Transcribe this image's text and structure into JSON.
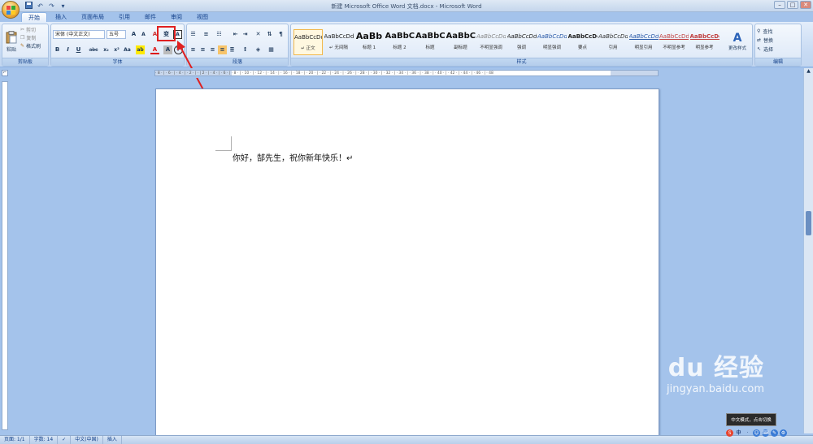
{
  "window": {
    "title": "新建 Microsoft Office Word 文档.docx - Microsoft Word",
    "controls": [
      "–",
      "□",
      "✕"
    ]
  },
  "qat": {
    "save_icon": "save-icon",
    "undo": "↶",
    "redo": "↷",
    "more": "▾"
  },
  "tabs": [
    "开始",
    "插入",
    "页面布局",
    "引用",
    "邮件",
    "审阅",
    "视图"
  ],
  "active_tab": "开始",
  "clipboard": {
    "paste": "粘贴",
    "cut": "剪切",
    "copy": "复制",
    "format_painter": "格式刷",
    "label": "剪贴板"
  },
  "font": {
    "name": "宋体 (中文正文)",
    "size": "五号",
    "grow": "A",
    "shrink": "A",
    "clear": "A",
    "phonetic": "变",
    "border": "A",
    "bold": "B",
    "italic": "I",
    "underline": "U",
    "strike": "abc",
    "subscript": "x₂",
    "superscript": "x²",
    "case": "Aa",
    "highlight": "ab",
    "color": "A",
    "shade": "A",
    "circle": "字",
    "label": "字体"
  },
  "paragraph": {
    "label": "段落"
  },
  "styles": {
    "label": "样式",
    "items": [
      {
        "preview": "AaBbCcDd",
        "name": "↵ 正文"
      },
      {
        "preview": "AaBbCcDd",
        "name": "↵ 无间隔"
      },
      {
        "preview": "AaBb",
        "name": "标题 1"
      },
      {
        "preview": "AaBbC",
        "name": "标题 2"
      },
      {
        "preview": "AaBbC",
        "name": "标题"
      },
      {
        "preview": "AaBbC",
        "name": "副标题"
      },
      {
        "preview": "AaBbCcDd",
        "name": "不明显强调"
      },
      {
        "preview": "AaBbCcDd",
        "name": "强调"
      },
      {
        "preview": "AaBbCcDd",
        "name": "明显强调"
      },
      {
        "preview": "AaBbCcDd",
        "name": "要点"
      },
      {
        "preview": "AaBbCcDd",
        "name": "引用"
      },
      {
        "preview": "AaBbCcDd",
        "name": "明显引用"
      },
      {
        "preview": "AaBbCcDd",
        "name": "不明显参考"
      },
      {
        "preview": "AaBbCcDd",
        "name": "明显参考"
      }
    ],
    "change_styles": "更改样式"
  },
  "editing": {
    "label": "编辑",
    "find": "查找",
    "replace": "替换",
    "select": "选择"
  },
  "ruler": {
    "ticks": "· 8 · | · 6 · | · 4 · | · 2 · | · | 2 · | · 4 · | · 6 · | · 8 · | · 10 · | · 12 · | · 14 · | · 16 · | · 18 · | · 20 · | · 22 · | · 24 · | · 26 · | · 28 · | · 30 · | · 32 · | · 34 · | · 36 · | · 38 · | · 40 · | · 42 · | · 44 · | · 46 · | · 48"
  },
  "document": {
    "text": "你好，郜先生，祝你新年快乐！↵"
  },
  "status": {
    "page": "页面: 1/1",
    "words": "字数: 14",
    "lang": "中文(中国)",
    "mode": "插入"
  },
  "watermark": {
    "brand": "Bai du 经验",
    "url": "jingyan.baidu.com"
  },
  "tooltip": "中文模式，点击切换",
  "tray": [
    "S",
    "中",
    "·",
    "☺",
    "⌨",
    "✎",
    "⚙"
  ]
}
